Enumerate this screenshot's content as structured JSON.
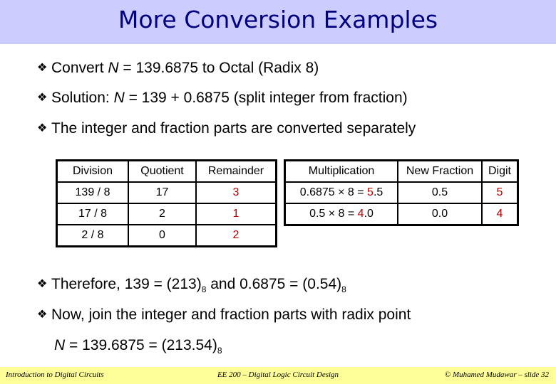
{
  "slide": {
    "title": "More Conversion Examples",
    "bullets": [
      {
        "pre": "Convert ",
        "var": "N",
        "post": " = 139.6875  to Octal (Radix 8)"
      },
      {
        "pre": "Solution: ",
        "var": "N",
        "post": " = 139 + 0.6875 (split integer from fraction)"
      },
      {
        "text": "The integer and fraction parts are converted separately"
      }
    ],
    "bullet_symbol": "❖",
    "division_table": {
      "headers": [
        "Division",
        "Quotient",
        "Remainder"
      ],
      "rows": [
        [
          "139 / 8",
          "17",
          "3"
        ],
        [
          "17 / 8",
          "2",
          "1"
        ],
        [
          "2 / 8",
          "0",
          "2"
        ]
      ]
    },
    "multiplication_table": {
      "headers": [
        "Multiplication",
        "New Fraction",
        "Digit"
      ],
      "rows": [
        {
          "pre": "0.6875 × 8 = ",
          "digit": "5",
          "post": ".5",
          "fraction": "0.5",
          "result": "5"
        },
        {
          "pre": "0.5 × 8 = ",
          "digit": "4",
          "post": ".0",
          "fraction": "0.0",
          "result": "4"
        }
      ]
    },
    "therefore": {
      "a": "Therefore, 139 = (213)",
      "sub1": "8",
      "b": " and 0.6875 = (0.54)",
      "sub2": "8"
    },
    "join_text": "Now, join the integer and fraction parts with radix point",
    "final": {
      "var": "N",
      "text": " = 139.6875 = (213.54)",
      "sub": "8"
    },
    "highlight_color": "#b80000"
  },
  "footer": {
    "left": "Introduction to Digital Circuits",
    "center": "EE 200 – Digital Logic Circuit Design",
    "right": "© Muhamed Mudawar – slide 32"
  }
}
